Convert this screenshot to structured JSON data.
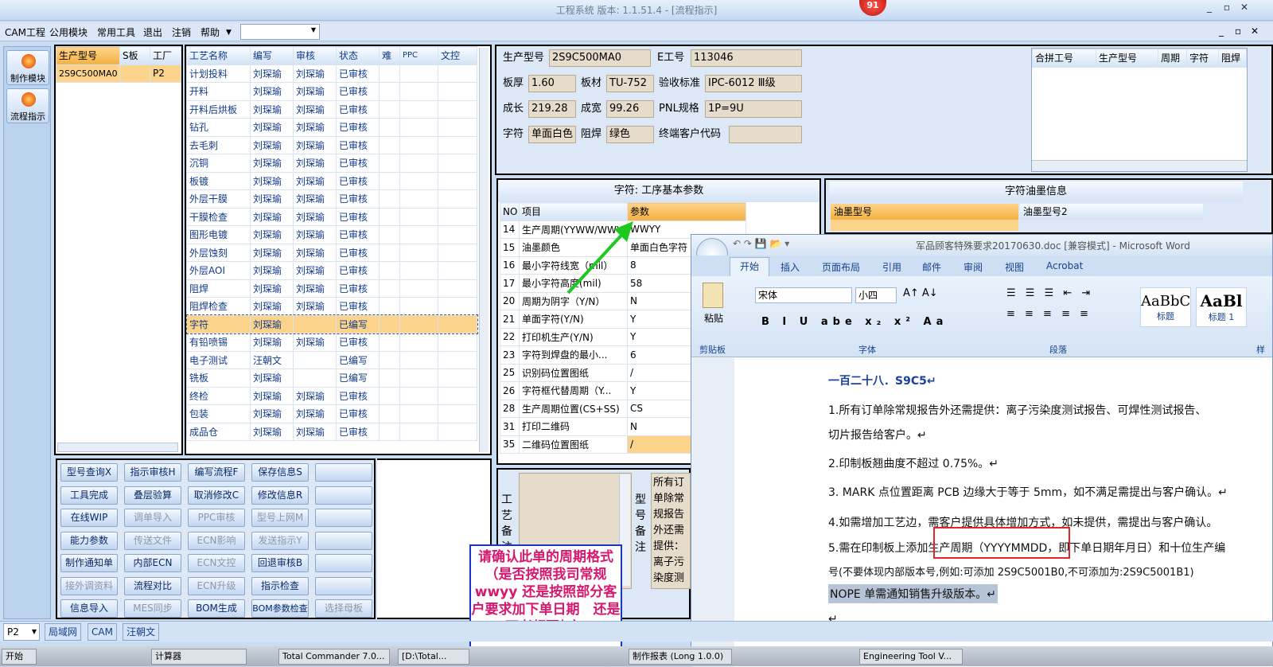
{
  "window": {
    "title": "工程系统 版本: 1.1.51.4 - [流程指示]",
    "badge": "91",
    "minimize": "_",
    "restore": "▫",
    "close": "✕"
  },
  "menu": [
    "CAM工程",
    "公用模块",
    "常用工具",
    "退出",
    "注销",
    "帮助"
  ],
  "left_nav": [
    "制作模块",
    "流程指示"
  ],
  "model_grid": {
    "headers": [
      "生产型号",
      "S板",
      "工厂"
    ],
    "rows": [
      [
        "2S9C500MA0",
        "",
        "P2"
      ]
    ]
  },
  "process_grid": {
    "headers": [
      "工艺名称",
      "编写",
      "审核",
      "状态",
      "难",
      "PPC",
      "文控"
    ],
    "rows": [
      [
        "计划投料",
        "刘琛瑜",
        "刘琛瑜",
        "已审核"
      ],
      [
        "开料",
        "刘琛瑜",
        "刘琛瑜",
        "已审核"
      ],
      [
        "开料后烘板",
        "刘琛瑜",
        "刘琛瑜",
        "已审核"
      ],
      [
        "钻孔",
        "刘琛瑜",
        "刘琛瑜",
        "已审核"
      ],
      [
        "去毛刺",
        "刘琛瑜",
        "刘琛瑜",
        "已审核"
      ],
      [
        "沉铜",
        "刘琛瑜",
        "刘琛瑜",
        "已审核"
      ],
      [
        "板镀",
        "刘琛瑜",
        "刘琛瑜",
        "已审核"
      ],
      [
        "外层干膜",
        "刘琛瑜",
        "刘琛瑜",
        "已审核"
      ],
      [
        "干膜检查",
        "刘琛瑜",
        "刘琛瑜",
        "已审核"
      ],
      [
        "图形电镀",
        "刘琛瑜",
        "刘琛瑜",
        "已审核"
      ],
      [
        "外层蚀刻",
        "刘琛瑜",
        "刘琛瑜",
        "已审核"
      ],
      [
        "外层AOI",
        "刘琛瑜",
        "刘琛瑜",
        "已审核"
      ],
      [
        "阻焊",
        "刘琛瑜",
        "刘琛瑜",
        "已审核"
      ],
      [
        "阻焊检查",
        "刘琛瑜",
        "刘琛瑜",
        "已审核"
      ],
      [
        "字符",
        "刘琛瑜",
        "",
        "已编写"
      ],
      [
        "有铅喷锡",
        "刘琛瑜",
        "刘琛瑜",
        "已审核"
      ],
      [
        "电子测试",
        "汪朝文",
        "",
        "已编写"
      ],
      [
        "铣板",
        "刘琛瑜",
        "",
        "已编写"
      ],
      [
        "终检",
        "刘琛瑜",
        "刘琛瑜",
        "已审核"
      ],
      [
        "包装",
        "刘琛瑜",
        "刘琛瑜",
        "已审核"
      ],
      [
        "成品仓",
        "刘琛瑜",
        "刘琛瑜",
        "已审核"
      ]
    ]
  },
  "buttons": [
    [
      "型号查询X",
      "指示审核H",
      "编写流程F",
      "保存信息S",
      ""
    ],
    [
      "工具完成",
      "叠层验算",
      "取消修改C",
      "修改信息R",
      ""
    ],
    [
      "在线WIP",
      "调单导入",
      "PPC审核",
      "型号上网M",
      ""
    ],
    [
      "能力参数",
      "传送文件",
      "ECN影响",
      "发送指示Y",
      ""
    ],
    [
      "制作通知单",
      "内部ECN",
      "ECN文控",
      "回退审核B",
      ""
    ],
    [
      "接外调资料",
      "流程对比",
      "ECN升级",
      "指示检查",
      ""
    ],
    [
      "信息导入",
      "MES同步",
      "BOM生成",
      "BOM参数检查",
      "选择母板"
    ]
  ],
  "info": {
    "prod_model_label": "生产型号",
    "prod_model": "2S9C500MA0",
    "e_no_label": "E工号",
    "e_no": "113046",
    "thickness_label": "板厚",
    "thickness": "1.60",
    "material_label": "板材",
    "material": "TU-752",
    "accept_label": "验收标准",
    "accept": "IPC-6012 Ⅲ级",
    "length_label": "成长",
    "length": "219.28",
    "width_label": "成宽",
    "width": "99.26",
    "pnl_label": "PNL规格",
    "pnl": "1P=9U",
    "char_label": "字符",
    "char": "单面白色",
    "mask_label": "阻焊",
    "mask": "绿色",
    "end_cust_label": "终端客户代码",
    "end_cust": ""
  },
  "merge_grid": {
    "headers": [
      "合拼工号",
      "生产型号",
      "周期",
      "字符",
      "阻焊"
    ]
  },
  "param_grid": {
    "title": "字符: 工序基本参数",
    "headers": [
      "NO",
      "项目",
      "参数"
    ],
    "rows": [
      [
        "14",
        "生产周期(YYWW/WWYY)",
        "WWYY"
      ],
      [
        "15",
        "油墨颜色",
        "单面白色字符"
      ],
      [
        "16",
        "最小字符线宽（mil）",
        "8"
      ],
      [
        "17",
        "最小字符高度(mil)",
        "58"
      ],
      [
        "20",
        "周期为阴字（Y/N）",
        "N"
      ],
      [
        "21",
        "单面字符(Y/N)",
        "Y"
      ],
      [
        "22",
        "打印机生产(Y/N)",
        "Y"
      ],
      [
        "23",
        "字符到焊盘的最小...",
        "6"
      ],
      [
        "25",
        "识别码位置图纸",
        "/"
      ],
      [
        "26",
        "字符框代替周期（Y...",
        "Y"
      ],
      [
        "28",
        "生产周期位置(CS+SS)",
        "CS"
      ],
      [
        "31",
        "打印二维码",
        "N"
      ],
      [
        "35",
        "二维码位置图纸",
        "/"
      ]
    ]
  },
  "ink_grid": {
    "title": "字符油墨信息",
    "headers": [
      "油墨型号",
      "油墨型号2"
    ]
  },
  "remarks": {
    "process_label": "工艺备注",
    "model_label": "型号备注",
    "model_text": "所有订单除常规报告外还需提供：离子污染度测试报告、可焊性测试报告、切片报告"
  },
  "word": {
    "title": "军品顾客特殊要求20170630.doc [兼容模式] - Microsoft Word",
    "tabs": [
      "开始",
      "插入",
      "页面布局",
      "引用",
      "邮件",
      "审阅",
      "视图",
      "Acrobat"
    ],
    "font": "宋体",
    "size": "小四",
    "paste": "粘贴",
    "clipboard": "剪贴板",
    "font_group": "字体",
    "para_group": "段落",
    "style_group": "样式",
    "style1": "标题",
    "style2": "标题 1",
    "sample1": "AaBbC",
    "sample2": "AaBl",
    "doc": [
      "一百二十八．S9C5↵",
      "1.所有订单除常规报告外还需提供：离子污染度测试报告、可焊性测试报告、",
      "切片报告给客户。↵",
      "2.印制板翘曲度不超过 0.75%。↵",
      "3. MARK 点位置距离 PCB 边缘大于等于 5mm，如不满足需提出与客户确认。↵",
      "4.如需增加工艺边，需客户提供具体增加方式，如未提供，需提出与客户确认。",
      "5.需在印制板上添加生产周期（YYYYMMDD，即下单日期年月日）和十位生产编",
      "号(不要体现内部版本号,例如:可添加 2S9C5001B0,不可添加为:2S9C5001B1)",
      "NOPE 单需通知销售升级版本。↵",
      "↵"
    ]
  },
  "note": "请确认此单的周期格式（是否按照我司常规wwyy 还是按照部分客户要求加下单日期　还是两者都要加）",
  "status": {
    "factory": "P2",
    "tabs": [
      "局域网",
      "CAM",
      "汪朝文"
    ]
  },
  "taskbar": [
    "开始",
    "计算器",
    "Total Commander 7.0...",
    "[D:\\Total...",
    "制作报表 (Long 1.0.0)",
    "Engineering Tool V..."
  ]
}
